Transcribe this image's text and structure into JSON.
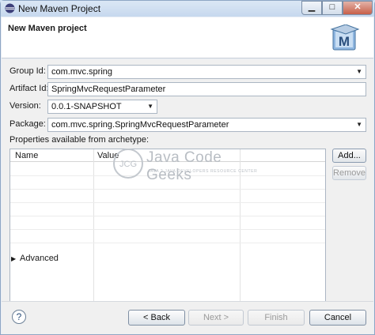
{
  "window": {
    "title": "New Maven Project"
  },
  "header": {
    "title": "New Maven project",
    "logo_letter": "M"
  },
  "form": {
    "group_id": {
      "label": "Group Id:",
      "value": "com.mvc.spring"
    },
    "artifact_id": {
      "label": "Artifact Id:",
      "value": "SpringMvcRequestParameter"
    },
    "version": {
      "label": "Version:",
      "value": "0.0.1-SNAPSHOT"
    },
    "package": {
      "label": "Package:",
      "value": "com.mvc.spring.SpringMvcRequestParameter"
    }
  },
  "properties": {
    "label": "Properties available from archetype:",
    "columns": [
      "Name",
      "Value"
    ],
    "add_label": "Add...",
    "remove_label": "Remove"
  },
  "advanced": {
    "label": "Advanced"
  },
  "footer": {
    "help": "?",
    "back_label": "< Back",
    "next_label": "Next >",
    "finish_label": "Finish",
    "cancel_label": "Cancel"
  },
  "watermark": {
    "logo_text": "JCG",
    "brand": "Java Code Geeks",
    "tagline": "JAVA 2 JAVA DEVELOPERS RESOURCE CENTER"
  },
  "colors": {
    "accent": "#2b6cb0",
    "title_bar": "#c6d8ee"
  },
  "icons": {
    "title": "eclipse-icon",
    "minimize": "minimize-icon",
    "maximize": "maximize-icon",
    "close": "close-icon",
    "dropdown": "chevron-down-icon",
    "expand": "triangle-right-icon",
    "help": "help-icon"
  }
}
